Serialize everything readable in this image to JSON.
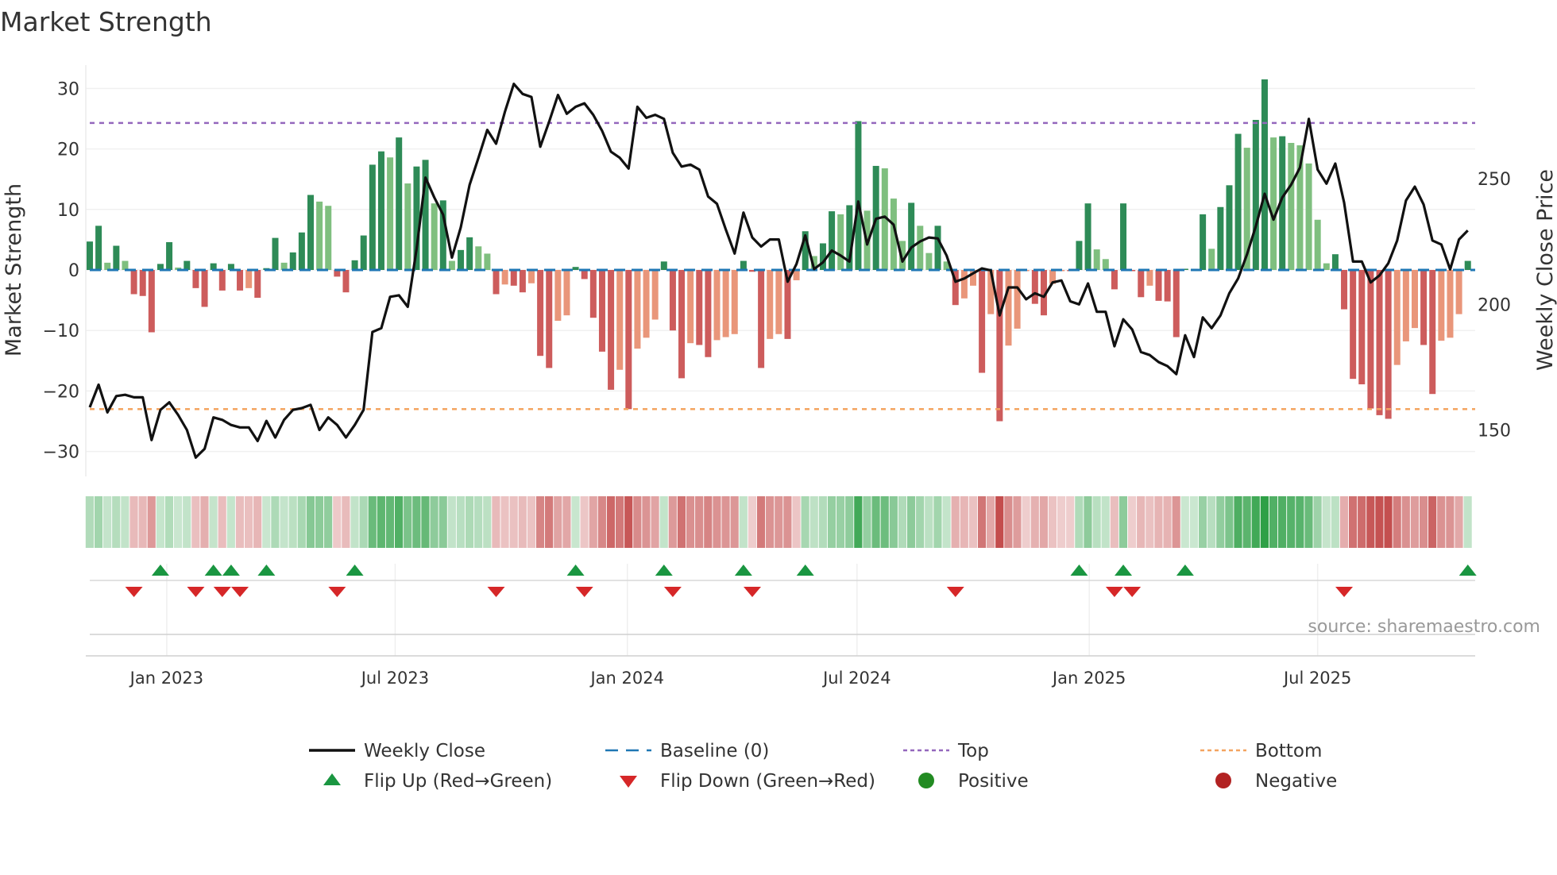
{
  "chart_data": {
    "type": "bar",
    "title": "Market Strength",
    "ylabel": "Market Strength",
    "y2label": "Weekly Close Price",
    "ylim": [
      -34,
      34
    ],
    "y_ticks": [
      30,
      20,
      10,
      0,
      -10,
      -20,
      -30
    ],
    "y_tick_labels": [
      "30",
      "20",
      "10",
      "0",
      "−10",
      "−20",
      "−30"
    ],
    "y2_ticks": [
      250,
      200,
      150
    ],
    "y2_tick_labels": [
      "250",
      "200",
      "150"
    ],
    "x_start": "2022-11-01",
    "x_step_days": 7,
    "x_ticks": [
      "2023-01-01",
      "2023-07-01",
      "2024-01-01",
      "2024-07-01",
      "2025-01-01",
      "2025-07-01"
    ],
    "x_tick_labels": [
      "Jan 2023",
      "Jul 2023",
      "Jan 2024",
      "Jul 2024",
      "Jan 2025",
      "Jul 2025"
    ],
    "top_level": 24.3,
    "bottom_level": -23,
    "baseline": 0,
    "grid": true,
    "legend_position": "bottom",
    "source": "source: sharemaestro.com",
    "series": [
      {
        "name": "Market Strength",
        "type": "bar",
        "values": [
          4.7,
          7.3,
          1.2,
          4,
          1.5,
          -4,
          -4.3,
          -10.3,
          1,
          4.6,
          0.4,
          1.5,
          -3,
          -6.1,
          1.1,
          -3.4,
          1,
          -3.4,
          -3,
          -4.6,
          0.3,
          5.3,
          1.2,
          2.9,
          6.2,
          12.4,
          11.3,
          10.6,
          -1.1,
          -3.7,
          1.6,
          5.7,
          17.4,
          19.6,
          18.6,
          21.9,
          14.3,
          17.1,
          18.2,
          11,
          11.5,
          1.5,
          3.3,
          5.4,
          3.9,
          2.7,
          -4,
          -2.4,
          -2.6,
          -3.7,
          -2.2,
          -14.2,
          -16.2,
          -8.4,
          -7.5,
          0.5,
          -1.5,
          -7.9,
          -13.5,
          -19.8,
          -16.5,
          -23,
          -13,
          -11.2,
          -8.2,
          1.4,
          -10,
          -17.9,
          -12.1,
          -12.4,
          -14.4,
          -11.6,
          -11.1,
          -10.6,
          1.5,
          -0.3,
          -16.2,
          -11.4,
          -10.6,
          -11.4,
          -1.7,
          6.4,
          2.3,
          4.4,
          9.7,
          9.2,
          10.7,
          24.6,
          9.8,
          17.2,
          16.8,
          11.8,
          4.8,
          11.1,
          7.3,
          2.8,
          7.3,
          1.4,
          -5.8,
          -4.7,
          -2.6,
          -17,
          -7.3,
          -25,
          -12.5,
          -9.7,
          -0.2,
          -5.6,
          -7.5,
          -2.3,
          -0.2,
          -0.2,
          4.8,
          11,
          3.4,
          1.8,
          -3.2,
          11,
          -0.2,
          -4.5,
          -2.6,
          -5.1,
          -5.2,
          -11.1,
          0.2,
          0.2,
          9.2,
          3.5,
          10.4,
          14,
          22.5,
          20.2,
          24.8,
          31.5,
          21.9,
          22.1,
          21,
          20.6,
          17.6,
          8.3,
          1.1,
          2.6,
          -6.5,
          -18,
          -18.9,
          -22.9,
          -24,
          -24.6,
          -15.7,
          -11.8,
          -9.6,
          -12.4,
          -20.5,
          -11.7,
          -11.2,
          -7.3,
          1.5
        ]
      },
      {
        "name": "Weekly Close",
        "type": "line",
        "axis": "right",
        "values": [
          159,
          168,
          157,
          163.5,
          164,
          163,
          163,
          146,
          158,
          161,
          156,
          150,
          139,
          142.5,
          155,
          154,
          152,
          151,
          151,
          145.6,
          153.6,
          147,
          154,
          158,
          158.7,
          160,
          150,
          155,
          152,
          147,
          152,
          158,
          189,
          190.5,
          203,
          203.6,
          199,
          222,
          250.4,
          242.5,
          235.7,
          218.6,
          230.6,
          247.6,
          258.3,
          269.4,
          263.9,
          276.6,
          287.7,
          283.7,
          282.5,
          262.7,
          272.6,
          283.3,
          275.8,
          278.6,
          280,
          275.4,
          269,
          260.7,
          258.3,
          254,
          278.6,
          274.2,
          275.4,
          273.8,
          260.3,
          254.8,
          255.6,
          253.6,
          242.9,
          240,
          229.8,
          220.2,
          236.5,
          226.6,
          223,
          225.8,
          225.8,
          209,
          216,
          227.4,
          214,
          216.7,
          221.4,
          219.4,
          217,
          240.9,
          223.8,
          234,
          234.9,
          231.7,
          217,
          222.6,
          225,
          226.6,
          226.2,
          219.4,
          209,
          210.3,
          212.3,
          214.3,
          213.5,
          195.6,
          206.7,
          206.7,
          202,
          204.4,
          203,
          208.7,
          209.5,
          201.2,
          200,
          208.3,
          197,
          197,
          183.3,
          194,
          190,
          181,
          179.8,
          177,
          175.4,
          172.2,
          187.7,
          179,
          194.8,
          190.5,
          195.6,
          204.4,
          210.3,
          219.8,
          231,
          244,
          233.7,
          242.5,
          247.6,
          254.4,
          273.8,
          253.6,
          248,
          256,
          240.5,
          217,
          217,
          208.7,
          211.5,
          216.3,
          225.4,
          241.3,
          246.8,
          239.7,
          225.4,
          223.8,
          213.9,
          225.8,
          229.4
        ]
      }
    ],
    "colors": {
      "strong_positive": "#2e8b57",
      "weak_positive": "#7fbf7f",
      "strong_negative": "#cd5c5c",
      "weak_negative": "#e9967a",
      "close_line": "#111111",
      "baseline": "#1f77b4",
      "top": "#9467bd",
      "bottom": "#f4a460",
      "flip_up": "#1a9641",
      "flip_down": "#d62728",
      "positive_dot": "#228b22",
      "negative_dot": "#b22222"
    },
    "legend": [
      {
        "label": "Weekly Close",
        "symbol": "line"
      },
      {
        "label": "Baseline (0)",
        "symbol": "dash"
      },
      {
        "label": "Top",
        "symbol": "dot-line-top"
      },
      {
        "label": "Bottom",
        "symbol": "dot-line-bottom"
      },
      {
        "label": "Flip Up (Red→Green)",
        "symbol": "triangle-up"
      },
      {
        "label": "Flip Down (Green→Red)",
        "symbol": "triangle-down"
      },
      {
        "label": "Positive",
        "symbol": "circle-positive"
      },
      {
        "label": "Negative",
        "symbol": "circle-negative"
      }
    ]
  }
}
